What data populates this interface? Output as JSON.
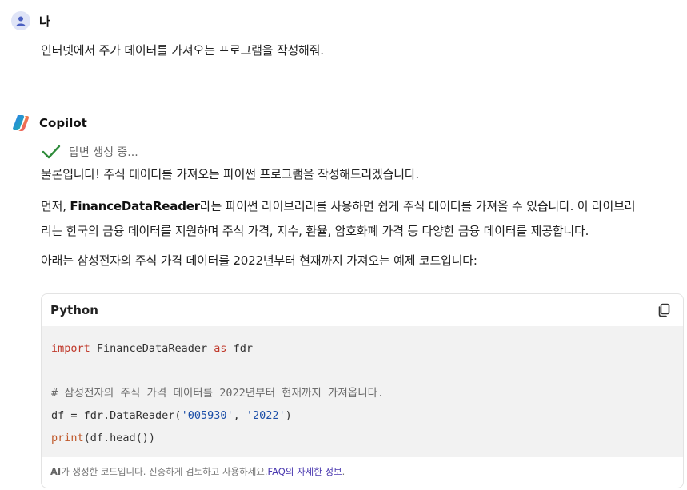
{
  "user_message": {
    "sender": "나",
    "text": "인터넷에서 주가 데이터를 가져오는 프로그램을 작성해줘."
  },
  "copilot_message": {
    "sender": "Copilot",
    "status": "답변 생성 중...",
    "intro": "물론입니다! 주식 데이터를 가져오는 파이썬 프로그램을 작성해드리겠습니다.",
    "para2_prefix": "먼저, ",
    "para2_bold": "FinanceDataReader",
    "para2_line1_rest": "라는 파이썬 라이브러리를 사용하면 쉽게 주식 데이터를 가져올 수 있습니다. 이 라이브러",
    "para2_line2": "리는 한국의 금융 데이터를 지원하며 주식 가격, 지수, 환율, 암호화폐 가격 등 다양한 금융 데이터를 제공합니다.",
    "para3": "아래는 삼성전자의 주식 가격 데이터를 2022년부터 현재까지 가져오는 예제 코드입니다:"
  },
  "code_block": {
    "language": "Python",
    "line1_kw1": "import",
    "line1_mid": " FinanceDataReader ",
    "line1_kw2": "as",
    "line1_end": " fdr",
    "comment": "# 삼성전자의 주식 가격 데이터를 2022년부터 현재까지 가져옵니다.",
    "line3_pre": "df = fdr.DataReader(",
    "line3_str1": "'005930'",
    "line3_sep": ", ",
    "line3_str2": "'2022'",
    "line3_end": ")",
    "line4_kw": "print",
    "line4_rest": "(df.head())",
    "footer_ai": "AI",
    "footer_text": "가 생성한 코드입니다. 신중하게 검토하고 사용하세요. ",
    "footer_link_faq": "FAQ",
    "footer_link_rest": "의 자세한 정보",
    "footer_end": "."
  },
  "colors": {
    "keyword": "#c0392b",
    "string": "#1c4fa8",
    "check": "#2e8b3a",
    "link": "#4b3ab0"
  },
  "icons": [
    "user-avatar-icon",
    "copilot-logo-icon",
    "check-icon",
    "copy-icon"
  ]
}
